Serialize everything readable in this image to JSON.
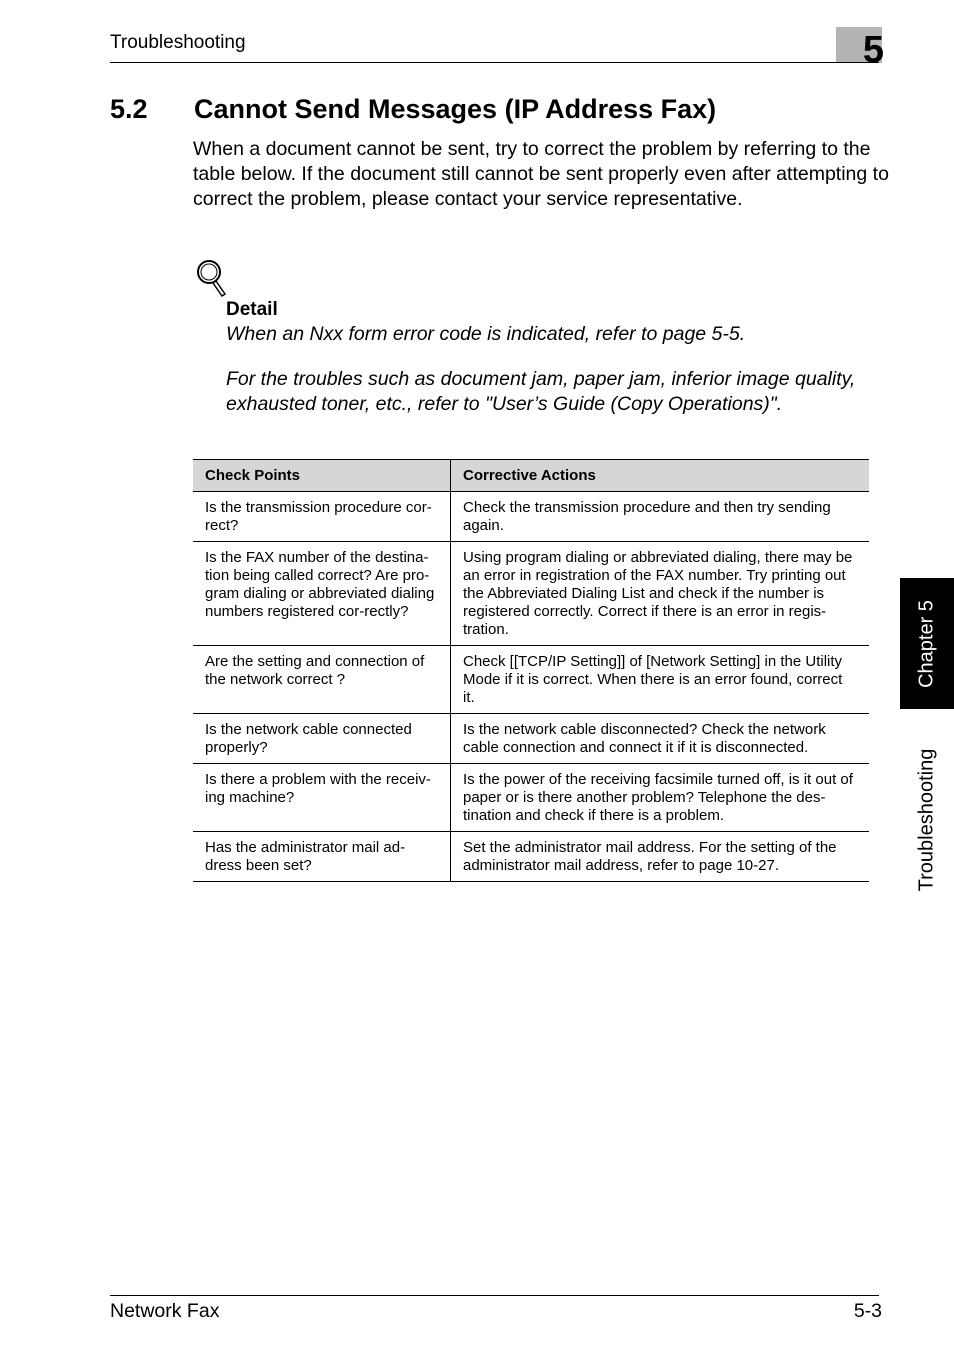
{
  "header": {
    "running_head": "Troubleshooting",
    "chapter_number": "5"
  },
  "section": {
    "number": "5.2",
    "title": "Cannot Send Messages (IP Address Fax)",
    "intro": "When a document cannot be sent, try to correct the problem by referring to the table below. If the document still cannot be sent properly even after attempting to correct the problem, please contact your service representative."
  },
  "detail_note": {
    "icon": "magnifier-icon",
    "label": "Detail",
    "text_1": "When an Nxx form error code is indicated, refer to page 5-5.",
    "text_2": "For the troubles such as document jam, paper jam, inferior image quality, exhausted toner, etc., refer to \"User’s Guide (Copy Operations)\"."
  },
  "table": {
    "headers": [
      "Check Points",
      "Corrective Actions"
    ],
    "rows": [
      [
        "Is the transmission procedure cor-rect?",
        "Check the transmission procedure and then try sending again."
      ],
      [
        "Is the FAX number of the destina-tion being called correct? Are pro-gram dialing or abbreviated dialing numbers registered cor-rectly?",
        "Using program dialing or abbreviated dialing, there may be an error in registration of the FAX number. Try printing out the Abbreviated Dialing List and check if the number is registered correctly. Correct if there is an error in regis-tration."
      ],
      [
        "Are the setting and connection of the network correct ?",
        "Check [[TCP/IP Setting]] of [Network Setting] in the Utility Mode if it is correct. When there is an error found, correct it."
      ],
      [
        "Is the network cable connected properly?",
        "Is the network cable disconnected? Check the network cable connection and connect it if it is disconnected."
      ],
      [
        "Is there a problem with the receiv-ing machine?",
        "Is the power of the receiving facsimile turned off, is it out of paper or is there another problem? Telephone the des-tination and check if there is a problem."
      ],
      [
        "Has the administrator mail ad-dress been set?",
        "Set the administrator mail address. For the setting of the administrator mail address, refer to page 10-27."
      ]
    ]
  },
  "side_tab": {
    "chapter": "Chapter 5",
    "section": "Troubleshooting"
  },
  "footer": {
    "left": "Network Fax",
    "page": "5-3"
  },
  "colors": {
    "table_header_bg": "#d6d6d6",
    "chapter_badge_bg": "#b4b4b4",
    "side_tab_bg": "#000000"
  }
}
